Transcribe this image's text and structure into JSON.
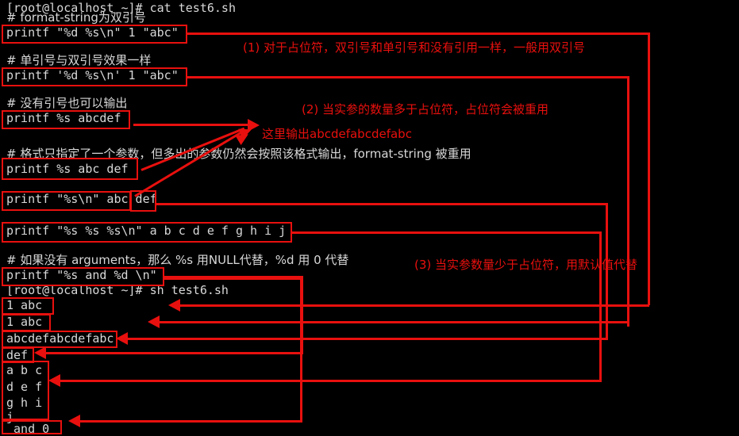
{
  "terminal": {
    "background": "#000000",
    "foreground": "#d8d8d8",
    "annotation_color": "#e8100e",
    "lines": [
      {
        "id": "l0",
        "text": "[root@localhost ~]# cat test6.sh"
      },
      {
        "id": "l1",
        "text": "# format-string为双引号"
      },
      {
        "id": "l2",
        "text": "printf \"%d %s\\n\" 1 \"abc\""
      },
      {
        "id": "l3",
        "text": ""
      },
      {
        "id": "l4",
        "text": "# 单引号与双引号效果一样"
      },
      {
        "id": "l5",
        "text": "printf '%d %s\\n' 1 \"abc\""
      },
      {
        "id": "l6",
        "text": ""
      },
      {
        "id": "l7",
        "text": "# 没有引号也可以输出"
      },
      {
        "id": "l8",
        "text": "printf %s abcdef"
      },
      {
        "id": "l9",
        "text": ""
      },
      {
        "id": "l10",
        "text": "# 格式只指定了一个参数，但多出的参数仍然会按照该格式输出，format-string 被重用"
      },
      {
        "id": "l11",
        "text": "printf %s abc def"
      },
      {
        "id": "l12",
        "text": ""
      },
      {
        "id": "l13",
        "text": "printf \"%s\\n\" abc def"
      },
      {
        "id": "l14",
        "text": ""
      },
      {
        "id": "l15",
        "text": "printf \"%s %s %s\\n\" a b c d e f g h i j"
      },
      {
        "id": "l16",
        "text": ""
      },
      {
        "id": "l17",
        "text": "# 如果没有 arguments，那么 %s 用NULL代替，%d 用 0 代替"
      },
      {
        "id": "l18",
        "text": "printf \"%s and %d \\n\""
      },
      {
        "id": "l19",
        "text": "[root@localhost ~]# sh test6.sh"
      },
      {
        "id": "l20",
        "text": "1 abc"
      },
      {
        "id": "l21",
        "text": "1 abc"
      },
      {
        "id": "l22",
        "text": "abcdefabcdefabc"
      },
      {
        "id": "l23",
        "text": "def"
      },
      {
        "id": "l24",
        "text": "a b c"
      },
      {
        "id": "l25",
        "text": "d e f"
      },
      {
        "id": "l26",
        "text": "g h i"
      },
      {
        "id": "l27",
        "text": "j"
      },
      {
        "id": "l28",
        "text": " and 0"
      }
    ]
  },
  "annotations": [
    {
      "id": "n1",
      "text": "(1) 对于占位符，双引号和单引号和没有引用一样，一般用双引号"
    },
    {
      "id": "n2",
      "text": "(2) 当实参的数量多于占位符，占位符会被重用"
    },
    {
      "id": "n3",
      "text": "这里输出abcdefabcdefabc"
    },
    {
      "id": "n4",
      "text": "(3) 当实参数量少于占位符，用默认值代替"
    }
  ]
}
